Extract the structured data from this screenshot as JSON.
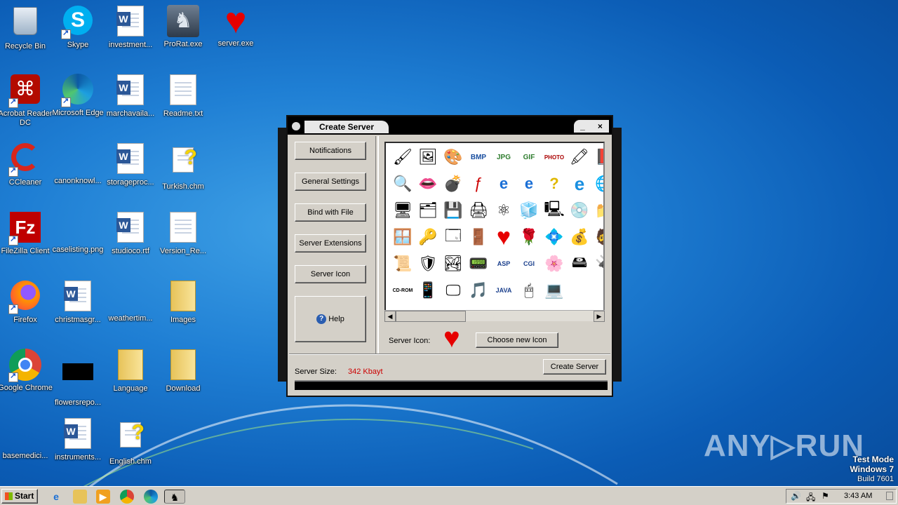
{
  "desktop": {
    "icons": [
      {
        "label": "Recycle Bin"
      },
      {
        "label": "Skype"
      },
      {
        "label": "investment..."
      },
      {
        "label": "ProRat.exe"
      },
      {
        "label": "server.exe"
      },
      {
        "label": "Acrobat Reader DC"
      },
      {
        "label": "Microsoft Edge"
      },
      {
        "label": "marchavaila..."
      },
      {
        "label": "Readme.txt"
      },
      {
        "label": "CCleaner"
      },
      {
        "label": "canonknowl..."
      },
      {
        "label": "storageproc..."
      },
      {
        "label": "Turkish.chm"
      },
      {
        "label": "FileZilla Client"
      },
      {
        "label": "caselisting.png"
      },
      {
        "label": "studioco.rtf"
      },
      {
        "label": "Version_Re..."
      },
      {
        "label": "Firefox"
      },
      {
        "label": "christmasgr..."
      },
      {
        "label": "weathertim..."
      },
      {
        "label": "Images"
      },
      {
        "label": "Google Chrome"
      },
      {
        "label": "flowersrepo..."
      },
      {
        "label": "Language"
      },
      {
        "label": "Download"
      },
      {
        "label": "basemedici..."
      },
      {
        "label": "instruments..."
      },
      {
        "label": "English.chm"
      }
    ]
  },
  "window": {
    "title": "Create Server",
    "minimize": "_",
    "close": "×",
    "nav": {
      "notifications": "Notifications",
      "general_settings": "General Settings",
      "bind_with_file": "Bind with File",
      "server_extensions": "Server Extensions",
      "server_icon": "Server Icon",
      "help": "Help"
    },
    "server_icon_label": "Server Icon:",
    "choose_new_icon": "Choose new Icon",
    "server_size_label": "Server Size:",
    "server_size_value": "342 Kbayt",
    "create_server": "Create Server",
    "icon_labels": {
      "bmp": "BMP",
      "jpg": "JPG",
      "gif": "GIF",
      "photo": "PHOTO",
      "asp": "ASP",
      "cgi": "CGI",
      "java": "JAVA",
      "cdrom": "CD-ROM"
    }
  },
  "taskbar": {
    "start": "Start",
    "clock": "3:43 AM"
  },
  "watermark": "ANY▷RUN",
  "test_mode": {
    "line1": "Test Mode",
    "line2": "Windows 7",
    "line3": "Build 7601"
  },
  "colors": {
    "server_size_value": "#cc0000",
    "heart": "#e60000"
  }
}
